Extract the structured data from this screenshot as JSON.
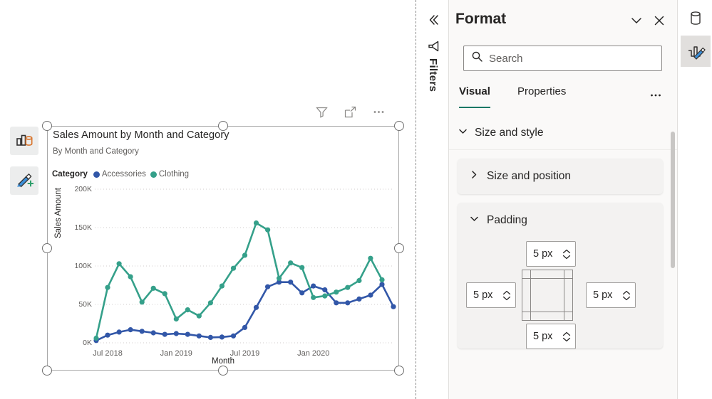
{
  "canvas": {
    "tools": [
      {
        "name": "build-visual-icon",
        "label": "Build visual"
      },
      {
        "name": "format-visual-icon",
        "label": "Format visual"
      }
    ],
    "visual_actions": [
      {
        "name": "filter-icon",
        "label": "Filters"
      },
      {
        "name": "focus-mode-icon",
        "label": "Focus mode"
      },
      {
        "name": "more-options-icon",
        "label": "More options"
      }
    ]
  },
  "filters_pane": {
    "collapse_label": "Expand filter pane",
    "funnel_label": "Filters",
    "title": "Filters"
  },
  "format_pane": {
    "title": "Format",
    "collapse_label": "Collapse pane",
    "close_label": "Close pane",
    "search": {
      "placeholder": "Search",
      "value": ""
    },
    "tabs": [
      {
        "label": "Visual",
        "active": true
      },
      {
        "label": "Properties",
        "active": false
      }
    ],
    "tabs_more_label": "More",
    "group": {
      "label": "Size and style",
      "expanded": true
    },
    "cards": [
      {
        "label": "Size and position",
        "expanded": false
      },
      {
        "label": "Padding",
        "expanded": true
      }
    ],
    "padding": {
      "top": "5 px",
      "left": "5 px",
      "right": "5 px",
      "bottom": "5 px"
    }
  },
  "right_rail": [
    {
      "name": "data-icon",
      "label": "Data"
    },
    {
      "name": "format-visual-icon",
      "label": "Format your visual",
      "selected": true
    }
  ],
  "colors": {
    "accessories": "#3257A8",
    "clothing": "#35A08A",
    "accent": "#117865",
    "panel_bg": "#faf9f8",
    "card_bg": "#f3f2f1"
  },
  "chart_data": {
    "type": "line",
    "title": "Sales Amount by Month and Category",
    "subtitle": "By Month and Category",
    "legend_title": "Category",
    "legend_position": "top",
    "xlabel": "Month",
    "ylabel": "Sales Amount",
    "ylim": [
      0,
      200000
    ],
    "yticks": [
      0,
      50000,
      100000,
      150000,
      200000
    ],
    "ytick_labels": [
      "0K",
      "50K",
      "100K",
      "150K",
      "200K"
    ],
    "grid": true,
    "xtick_labels": [
      "Jul 2018",
      "Jan 2019",
      "Jul 2019",
      "Jan 2020"
    ],
    "xtick_indices": [
      1,
      7,
      13,
      19
    ],
    "x": [
      "Jun 2018",
      "Jul 2018",
      "Aug 2018",
      "Sep 2018",
      "Oct 2018",
      "Nov 2018",
      "Dec 2018",
      "Jan 2019",
      "Feb 2019",
      "Mar 2019",
      "Apr 2019",
      "May 2019",
      "Jun 2019",
      "Jul 2019",
      "Aug 2019",
      "Sep 2019",
      "Oct 2019",
      "Nov 2019",
      "Dec 2019",
      "Jan 2020",
      "Feb 2020",
      "Mar 2020",
      "Apr 2020",
      "May 2020",
      "Jun 2020"
    ],
    "series": [
      {
        "name": "Accessories",
        "color": "#3257A8",
        "values": [
          3000,
          10000,
          14000,
          17000,
          15000,
          13000,
          11000,
          12000,
          11000,
          9000,
          7000,
          7500,
          9000,
          20000,
          46000,
          73000,
          79000,
          79000,
          65000,
          74000,
          69000,
          52000,
          52000,
          57000,
          62000,
          76000,
          47000
        ]
      },
      {
        "name": "Clothing",
        "color": "#35A08A",
        "values": [
          6000,
          72000,
          103000,
          86000,
          53000,
          71000,
          64000,
          31000,
          43000,
          35000,
          52000,
          74000,
          97000,
          114000,
          156000,
          147000,
          84000,
          104000,
          98000,
          59000,
          61000,
          66000,
          72000,
          81000,
          110000,
          82000
        ]
      }
    ]
  }
}
